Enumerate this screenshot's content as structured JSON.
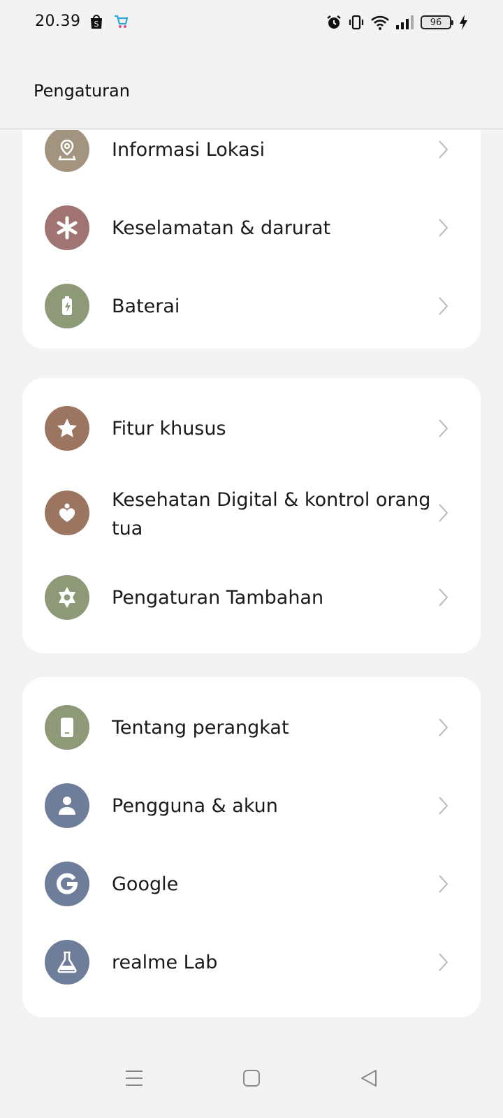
{
  "status_bar": {
    "time": "20.39",
    "left_icons": [
      "shopee-bag-icon",
      "app-cart-icon"
    ],
    "right_icons": [
      "alarm-icon",
      "vibrate-icon",
      "wifi-icon",
      "signal-icon",
      "battery-icon",
      "charging-icon"
    ],
    "battery_level": "96"
  },
  "header": {
    "title": "Pengaturan"
  },
  "groups": [
    {
      "items": [
        {
          "label": "Informasi Lokasi",
          "icon": "location-pin-icon",
          "icon_color": "#a39480"
        },
        {
          "label": "Keselamatan & darurat",
          "icon": "asterisk-icon",
          "icon_color": "#a07472"
        },
        {
          "label": "Baterai",
          "icon": "battery-charge-icon",
          "icon_color": "#8e9a77"
        }
      ]
    },
    {
      "items": [
        {
          "label": "Fitur khusus",
          "icon": "star-icon",
          "icon_color": "#9c7560"
        },
        {
          "label": "Kesehatan Digital & kontrol orang tua",
          "icon": "heart-person-icon",
          "icon_color": "#9c7560"
        },
        {
          "label": "Pengaturan Tambahan",
          "icon": "gear-star-icon",
          "icon_color": "#8e9a77"
        }
      ]
    },
    {
      "items": [
        {
          "label": "Tentang perangkat",
          "icon": "phone-icon",
          "icon_color": "#8e9a77"
        },
        {
          "label": "Pengguna & akun",
          "icon": "user-icon",
          "icon_color": "#6e7d9a"
        },
        {
          "label": "Google",
          "icon": "google-icon",
          "icon_color": "#6e7d9a"
        },
        {
          "label": "realme Lab",
          "icon": "flask-icon",
          "icon_color": "#6e7d9a"
        }
      ]
    }
  ],
  "nav_bar": {
    "buttons": [
      "menu-icon",
      "home-icon",
      "back-icon"
    ]
  }
}
